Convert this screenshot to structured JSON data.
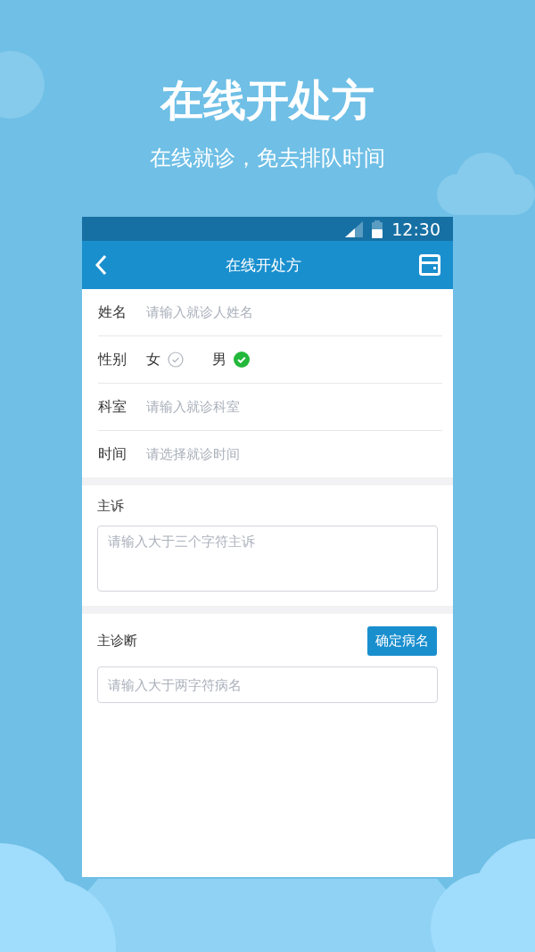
{
  "headline": "在线开处方",
  "subtitle": "在线就诊，免去排队时间",
  "status_bar": {
    "time": "12:30"
  },
  "app_bar": {
    "title": "在线开处方"
  },
  "form": {
    "rows": [
      {
        "kind": "input",
        "label": "姓名",
        "placeholder": "请输入就诊人姓名"
      },
      {
        "kind": "radio",
        "label": "性别",
        "options": [
          {
            "label": "女",
            "selected": false
          },
          {
            "label": "男",
            "selected": true
          }
        ]
      },
      {
        "kind": "input",
        "label": "科室",
        "placeholder": "请输入就诊科室"
      },
      {
        "kind": "input",
        "label": "时间",
        "placeholder": "请选择就诊时间"
      }
    ]
  },
  "complaint": {
    "label": "主诉",
    "placeholder": "请输入大于三个字符主诉"
  },
  "diagnosis": {
    "label": "主诊断",
    "button": "确定病名",
    "placeholder": "请输入大于两字符病名"
  }
}
